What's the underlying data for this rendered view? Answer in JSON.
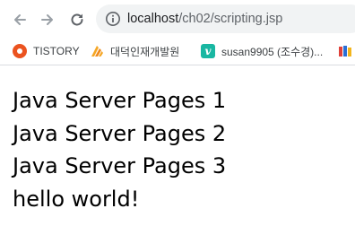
{
  "toolbar": {
    "back_icon": "arrow-left-icon",
    "forward_icon": "arrow-right-icon",
    "reload_icon": "reload-icon",
    "info_icon": "info-icon",
    "url_host": "localhost",
    "url_path": "/ch02/scripting.jsp"
  },
  "bookmarks": [
    {
      "label": "TISTORY",
      "icon": "tistory-icon"
    },
    {
      "label": "대덕인재개발원",
      "icon": "daeduck-icon"
    },
    {
      "label": "susan9905 (조수경)...",
      "icon": "vimeo-icon",
      "icon_glyph": "v"
    },
    {
      "label": "",
      "icon": "more-bookmarks-icon"
    }
  ],
  "content": {
    "lines": [
      "Java Server Pages 1",
      "Java Server Pages 2",
      "Java Server Pages 3",
      "hello world!"
    ]
  },
  "colors": {
    "text": "#000000",
    "omnibox_bg": "#f1f3f4",
    "tistory_brand": "#eb531f",
    "vimeo_brand": "#19b7a2",
    "icon_gray": "#5f6368"
  }
}
